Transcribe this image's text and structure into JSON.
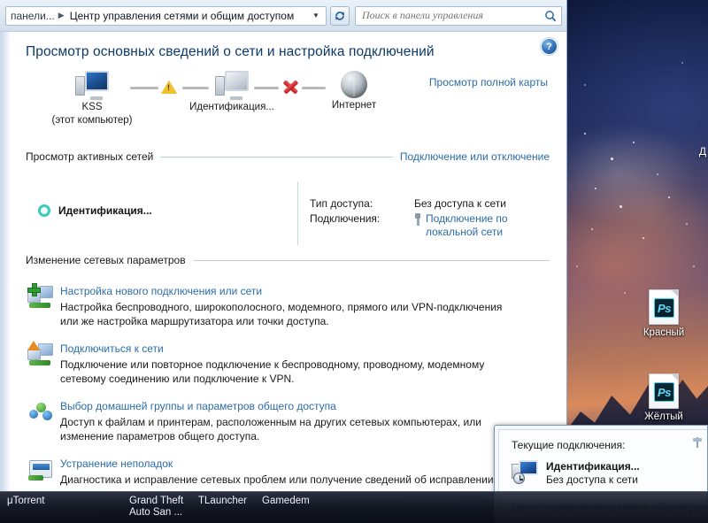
{
  "addressbar": {
    "crumb_root": "панели...",
    "crumb_sep": "▶",
    "crumb_current": "Центр управления сетями и общим доступом",
    "dropdown_icon": "▼",
    "refresh_icon": "refresh-icon",
    "search_placeholder": "Поиск в панели управления",
    "search_value": "",
    "search_icon": "search-icon"
  },
  "content": {
    "help_label": "?",
    "page_title": "Просмотр основных сведений о сети и настройка подключений",
    "full_map_link": "Просмотр полной карты",
    "netmap": {
      "nodes": [
        {
          "label": "KSS",
          "sublabel": "(этот компьютер)",
          "icon": "computer-icon"
        },
        {
          "label": "Идентификация...",
          "sublabel": "",
          "icon": "multiple-networks-icon"
        },
        {
          "label": "Интернет",
          "sublabel": "",
          "icon": "globe-icon"
        }
      ],
      "link1_status": "warning",
      "link2_status": "error"
    },
    "active_networks": {
      "header": "Просмотр активных сетей",
      "action_link": "Подключение или отключение",
      "network_name": "Идентификация...",
      "details": [
        {
          "key": "Тип доступа:",
          "value": "Без доступа к сети",
          "is_link": false
        },
        {
          "key": "Подключения:",
          "value": "Подключение по локальной сети",
          "is_link": true
        }
      ]
    },
    "change_settings": {
      "header": "Изменение сетевых параметров",
      "items": [
        {
          "icon": "new-connection-icon",
          "title": "Настройка нового подключения или сети",
          "desc": "Настройка беспроводного, широкополосного, модемного, прямого или VPN-подключения или же настройка маршрутизатора или точки доступа."
        },
        {
          "icon": "connect-to-network-icon",
          "title": "Подключиться к сети",
          "desc": "Подключение или повторное подключение к беспроводному, проводному, модемному сетевому соединению или подключение к VPN."
        },
        {
          "icon": "homegroup-icon",
          "title": "Выбор домашней группы и параметров общего доступа",
          "desc": "Доступ к файлам и принтерам, расположенным на других сетевых компьютерах, или изменение параметров общего доступа."
        },
        {
          "icon": "troubleshoot-icon",
          "title": "Устранение неполадок",
          "desc": "Диагностика и исправление сетевых проблем или получение сведений об исправлении"
        }
      ]
    }
  },
  "flyout": {
    "title": "Текущие подключения:",
    "connection_name": "Идентификация...",
    "connection_status": "Без доступа к сети",
    "link": "Центр управления сетями и общим досту",
    "pin_icon": "pin-icon"
  },
  "desktop": {
    "icons": [
      {
        "label": "Красный",
        "badge": "Ps"
      },
      {
        "label": "Жёлтый",
        "badge": "Ps"
      }
    ],
    "edge_letter": "Д"
  },
  "taskbar": {
    "buttons": [
      {
        "label": "μTorrent"
      },
      {
        "label": "Grand Theft\nAuto San ..."
      },
      {
        "label": "TLauncher"
      },
      {
        "label": "Gamedem"
      }
    ]
  },
  "colors": {
    "link": "#2a6ca8",
    "title": "#0a3a6b",
    "accent_ring": "#3ec8c0",
    "warning": "#f2c12e",
    "error": "#bf1515"
  }
}
